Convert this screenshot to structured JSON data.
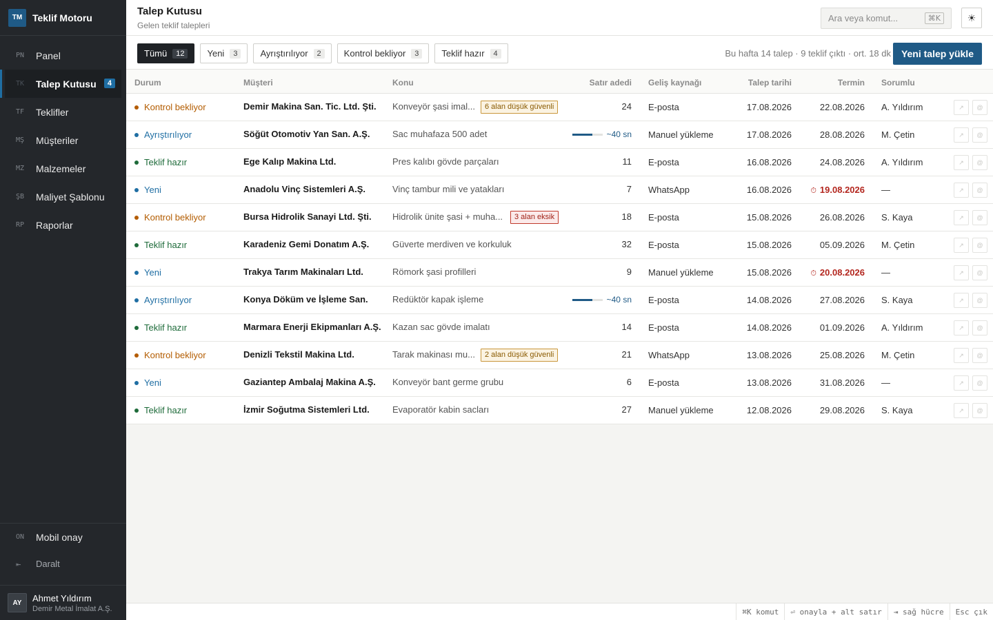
{
  "brand": {
    "logo": "TM",
    "name": "Teklif Motoru"
  },
  "nav": [
    {
      "code": "PN",
      "label": "Panel",
      "active": false
    },
    {
      "code": "TK",
      "label": "Talep Kutusu",
      "active": true,
      "badge": "4"
    },
    {
      "code": "TF",
      "label": "Teklifler",
      "active": false
    },
    {
      "code": "MŞ",
      "label": "Müşteriler",
      "active": false
    },
    {
      "code": "MZ",
      "label": "Malzemeler",
      "active": false
    },
    {
      "code": "ŞB",
      "label": "Maliyet Şablonu",
      "active": false
    },
    {
      "code": "RP",
      "label": "Raporlar",
      "active": false
    }
  ],
  "side_bottom": {
    "mobile": {
      "code": "ON",
      "label": "Mobil onay"
    },
    "collapse": {
      "icon": "⇤",
      "label": "Daralt"
    }
  },
  "user": {
    "initials": "AY",
    "name": "Ahmet Yıldırım",
    "org": "Demir Metal İmalat A.Ş."
  },
  "header": {
    "title": "Talep Kutusu",
    "subtitle": "Gelen teklif talepleri",
    "search_placeholder": "Ara veya komut...",
    "search_kbd": "⌘K",
    "theme_icon": "☀"
  },
  "filters": [
    {
      "label": "Tümü",
      "count": "12",
      "active": true
    },
    {
      "label": "Yeni",
      "count": "3",
      "active": false
    },
    {
      "label": "Ayrıştırılıyor",
      "count": "2",
      "active": false
    },
    {
      "label": "Kontrol bekliyor",
      "count": "3",
      "active": false
    },
    {
      "label": "Teklif hazır",
      "count": "4",
      "active": false
    }
  ],
  "stats": "Bu hafta 14 talep · 9 teklif çıktı · ort. 18 dk",
  "upload_button": "Yeni talep yükle",
  "columns": {
    "status": "Durum",
    "customer": "Müşteri",
    "subject": "Konu",
    "qty": "Satır adedi",
    "source": "Geliş kaynağı",
    "reqdate": "Talep tarihi",
    "deadline": "Termin",
    "owner": "Sorumlu"
  },
  "status_colors": {
    "Kontrol bekliyor": "#b35c00",
    "Ayrıştırılıyor": "#1f6ea3",
    "Teklif hazır": "#1e6b3a",
    "Yeni": "#1f6ea3"
  },
  "rows": [
    {
      "status": "Kontrol bekliyor",
      "customer": "Demir Makina San. Tic. Ltd. Şti.",
      "subject": "Konveyör şasi imal...",
      "tag": "6 alan düşük güvenli",
      "tag_color": "amber",
      "qty": "24",
      "source": "E-posta",
      "reqdate": "17.08.2026",
      "deadline": "22.08.2026",
      "late": false,
      "owner": "A. Yıldırım"
    },
    {
      "status": "Ayrıştırılıyor",
      "customer": "Söğüt Otomotiv Yan San. A.Ş.",
      "subject": "Sac muhafaza 500 adet",
      "progress": 0.65,
      "progress_text": "~40 sn",
      "source": "Manuel yükleme",
      "reqdate": "17.08.2026",
      "deadline": "28.08.2026",
      "late": false,
      "owner": "M. Çetin"
    },
    {
      "status": "Teklif hazır",
      "customer": "Ege Kalıp Makina Ltd.",
      "subject": "Pres kalıbı gövde parçaları",
      "qty": "11",
      "source": "E-posta",
      "reqdate": "16.08.2026",
      "deadline": "24.08.2026",
      "late": false,
      "owner": "A. Yıldırım"
    },
    {
      "status": "Yeni",
      "customer": "Anadolu Vinç Sistemleri A.Ş.",
      "subject": "Vinç tambur mili ve yatakları",
      "qty": "7",
      "source": "WhatsApp",
      "reqdate": "16.08.2026",
      "deadline": "19.08.2026",
      "late": true,
      "owner": "—"
    },
    {
      "status": "Kontrol bekliyor",
      "customer": "Bursa Hidrolik Sanayi Ltd. Şti.",
      "subject": "Hidrolik ünite şasi + muha...",
      "tag": "3 alan eksik",
      "tag_color": "red",
      "qty": "18",
      "source": "E-posta",
      "reqdate": "15.08.2026",
      "deadline": "26.08.2026",
      "late": false,
      "owner": "S. Kaya"
    },
    {
      "status": "Teklif hazır",
      "customer": "Karadeniz Gemi Donatım A.Ş.",
      "subject": "Güverte merdiven ve korkuluk",
      "qty": "32",
      "source": "E-posta",
      "reqdate": "15.08.2026",
      "deadline": "05.09.2026",
      "late": false,
      "owner": "M. Çetin"
    },
    {
      "status": "Yeni",
      "customer": "Trakya Tarım Makinaları Ltd.",
      "subject": "Römork şasi profilleri",
      "qty": "9",
      "source": "Manuel yükleme",
      "reqdate": "15.08.2026",
      "deadline": "20.08.2026",
      "late": true,
      "owner": "—"
    },
    {
      "status": "Ayrıştırılıyor",
      "customer": "Konya Döküm ve İşleme San.",
      "subject": "Redüktör kapak işleme",
      "progress": 0.65,
      "progress_text": "~40 sn",
      "source": "E-posta",
      "reqdate": "14.08.2026",
      "deadline": "27.08.2026",
      "late": false,
      "owner": "S. Kaya"
    },
    {
      "status": "Teklif hazır",
      "customer": "Marmara Enerji Ekipmanları A.Ş.",
      "subject": "Kazan sac gövde imalatı",
      "qty": "14",
      "source": "E-posta",
      "reqdate": "14.08.2026",
      "deadline": "01.09.2026",
      "late": false,
      "owner": "A. Yıldırım"
    },
    {
      "status": "Kontrol bekliyor",
      "customer": "Denizli Tekstil Makina Ltd.",
      "subject": "Tarak makinası mu...",
      "tag": "2 alan düşük güvenli",
      "tag_color": "amber",
      "qty": "21",
      "source": "WhatsApp",
      "reqdate": "13.08.2026",
      "deadline": "25.08.2026",
      "late": false,
      "owner": "M. Çetin"
    },
    {
      "status": "Yeni",
      "customer": "Gaziantep Ambalaj Makina A.Ş.",
      "subject": "Konveyör bant germe grubu",
      "qty": "6",
      "source": "E-posta",
      "reqdate": "13.08.2026",
      "deadline": "31.08.2026",
      "late": false,
      "owner": "—"
    },
    {
      "status": "Teklif hazır",
      "customer": "İzmir Soğutma Sistemleri Ltd.",
      "subject": "Evaporatör kabin sacları",
      "qty": "27",
      "source": "Manuel yükleme",
      "reqdate": "12.08.2026",
      "deadline": "29.08.2026",
      "late": false,
      "owner": "S. Kaya"
    }
  ],
  "row_actions": {
    "open_icon": "↗",
    "mail_icon": "@"
  },
  "late_icon": "⏱",
  "hints": [
    "⌘K komut",
    "⏎ onayla + alt satır",
    "⇥ sağ hücre",
    "Esc çık"
  ]
}
